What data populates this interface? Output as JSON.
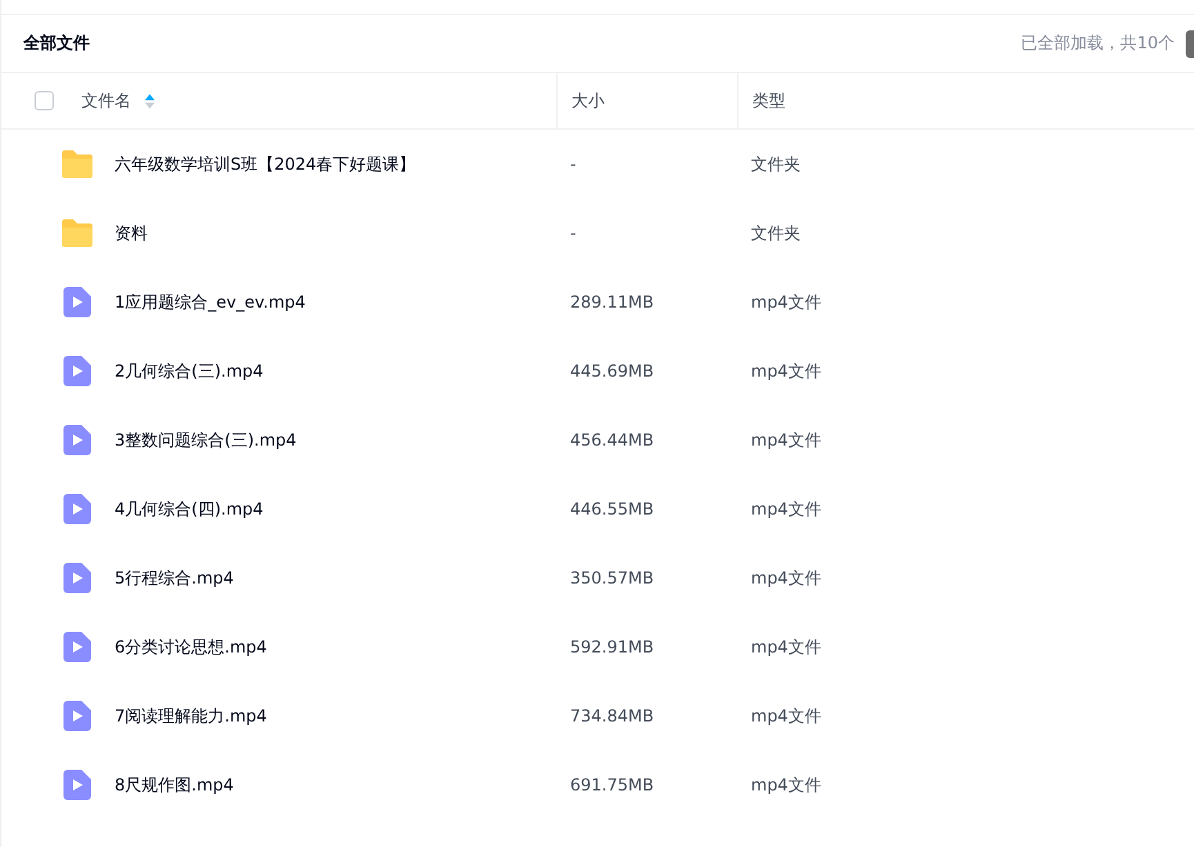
{
  "header": {
    "title": "全部文件",
    "status": "已全部加载，共10个"
  },
  "select_all": {
    "checked": false
  },
  "columns": [
    {
      "label": "文件名",
      "sort_ascending": true
    },
    {
      "label": "大小"
    },
    {
      "label": "类型"
    }
  ],
  "rows": [
    {
      "kind": "folder",
      "name": "六年级数学培训S班【2024春下好题课】",
      "size": "-",
      "type": "文件夹"
    },
    {
      "kind": "folder",
      "name": "资料",
      "size": "-",
      "type": "文件夹"
    },
    {
      "kind": "video",
      "name": "1应用题综合_ev_ev.mp4",
      "size": "289.11MB",
      "type": "mp4文件"
    },
    {
      "kind": "video",
      "name": "2几何综合(三).mp4",
      "size": "445.69MB",
      "type": "mp4文件"
    },
    {
      "kind": "video",
      "name": "3整数问题综合(三).mp4",
      "size": "456.44MB",
      "type": "mp4文件"
    },
    {
      "kind": "video",
      "name": "4几何综合(四).mp4",
      "size": "446.55MB",
      "type": "mp4文件"
    },
    {
      "kind": "video",
      "name": "5行程综合.mp4",
      "size": "350.57MB",
      "type": "mp4文件"
    },
    {
      "kind": "video",
      "name": "6分类讨论思想.mp4",
      "size": "592.91MB",
      "type": "mp4文件"
    },
    {
      "kind": "video",
      "name": "7阅读理解能力.mp4",
      "size": "734.84MB",
      "type": "mp4文件"
    },
    {
      "kind": "video",
      "name": "8尺规作图.mp4",
      "size": "691.75MB",
      "type": "mp4文件"
    }
  ]
}
